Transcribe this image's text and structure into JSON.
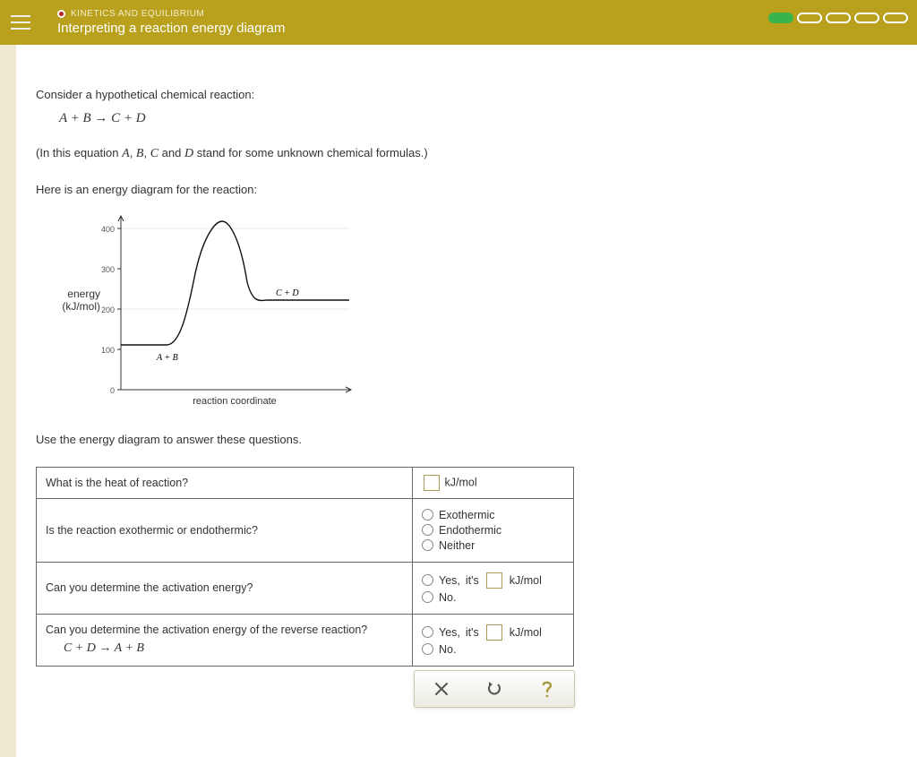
{
  "header": {
    "category": "KINETICS AND EQUILIBRIUM",
    "title": "Interpreting a reaction energy diagram",
    "progress_total": 5,
    "progress_filled": 1
  },
  "intro": {
    "line1": "Consider a hypothetical chemical reaction:",
    "equation1": "A + B → C + D",
    "line2_pre": "(In this equation ",
    "var_a": "A",
    "var_b": "B",
    "var_c": "C",
    "var_d": "D",
    "line2_mid1": ", ",
    "line2_mid2": ", ",
    "line2_mid3": " and ",
    "line2_post": " stand for some unknown chemical formulas.)",
    "line3": "Here is an energy diagram for the reaction:",
    "line4": "Use the energy diagram to answer these questions."
  },
  "chart_data": {
    "type": "line",
    "title": "",
    "xlabel": "reaction coordinate",
    "ylabel_line1": "energy",
    "ylabel_line2": "(kJ/mol)",
    "ylim": [
      0,
      420
    ],
    "yticks": [
      0,
      100,
      200,
      300,
      400
    ],
    "series": [
      {
        "name": "A + B",
        "label": "A  +  B",
        "x": [
          0.0,
          0.2,
          0.32,
          0.4,
          0.48,
          0.56,
          0.64,
          1.0
        ],
        "y": [
          110,
          110,
          200,
          380,
          415,
          380,
          220,
          220
        ]
      }
    ],
    "annotations": [
      {
        "text": "A  +  B",
        "x": 0.16,
        "y": 135
      },
      {
        "text": "C  +  D",
        "x": 0.72,
        "y": 228
      }
    ]
  },
  "questions": {
    "q1": {
      "prompt": "What is the heat of reaction?",
      "unit": "kJ/mol"
    },
    "q2": {
      "prompt": "Is the reaction exothermic or endothermic?",
      "opt1": "Exothermic",
      "opt2": "Endothermic",
      "opt3": "Neither"
    },
    "q3": {
      "prompt": "Can you determine the activation energy?",
      "yes_pre": "Yes, ",
      "yes_mid": "it's ",
      "unit": "kJ/mol",
      "no": "No."
    },
    "q4": {
      "prompt": "Can you determine the activation energy of the reverse reaction?",
      "equation": "C + D → A + B",
      "yes_pre": "Yes, ",
      "yes_mid": "it's ",
      "unit": "kJ/mol",
      "no": "No."
    }
  },
  "actions": {
    "clear": "clear",
    "reset": "reset",
    "help": "help"
  }
}
